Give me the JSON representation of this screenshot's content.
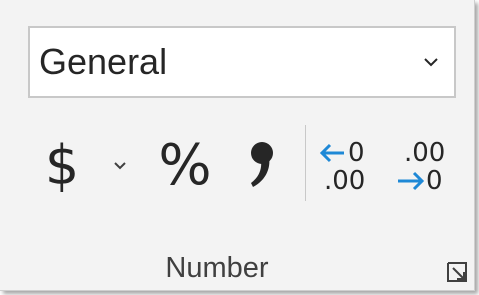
{
  "number_format": {
    "value": "General",
    "dropdown_icon": "chevron-down-icon"
  },
  "buttons": {
    "currency": {
      "symbol": "$",
      "icon": "dollar-icon"
    },
    "currency_dropdown": {
      "icon": "chevron-down-icon"
    },
    "percent": {
      "symbol": "%",
      "icon": "percent-icon"
    },
    "comma": {
      "symbol": ",",
      "icon": "comma-style-icon"
    },
    "increase_decimal": {
      "top": "0",
      "bottom": ".00",
      "icon": "increase-decimal-icon"
    },
    "decrease_decimal": {
      "top": ".00",
      "bottom": "0",
      "icon": "decrease-decimal-icon"
    }
  },
  "group": {
    "label": "Number",
    "launcher_icon": "dialog-launcher-icon"
  },
  "colors": {
    "arrow": "#1e88d6",
    "text": "#262626",
    "background": "#f3f3f3"
  }
}
